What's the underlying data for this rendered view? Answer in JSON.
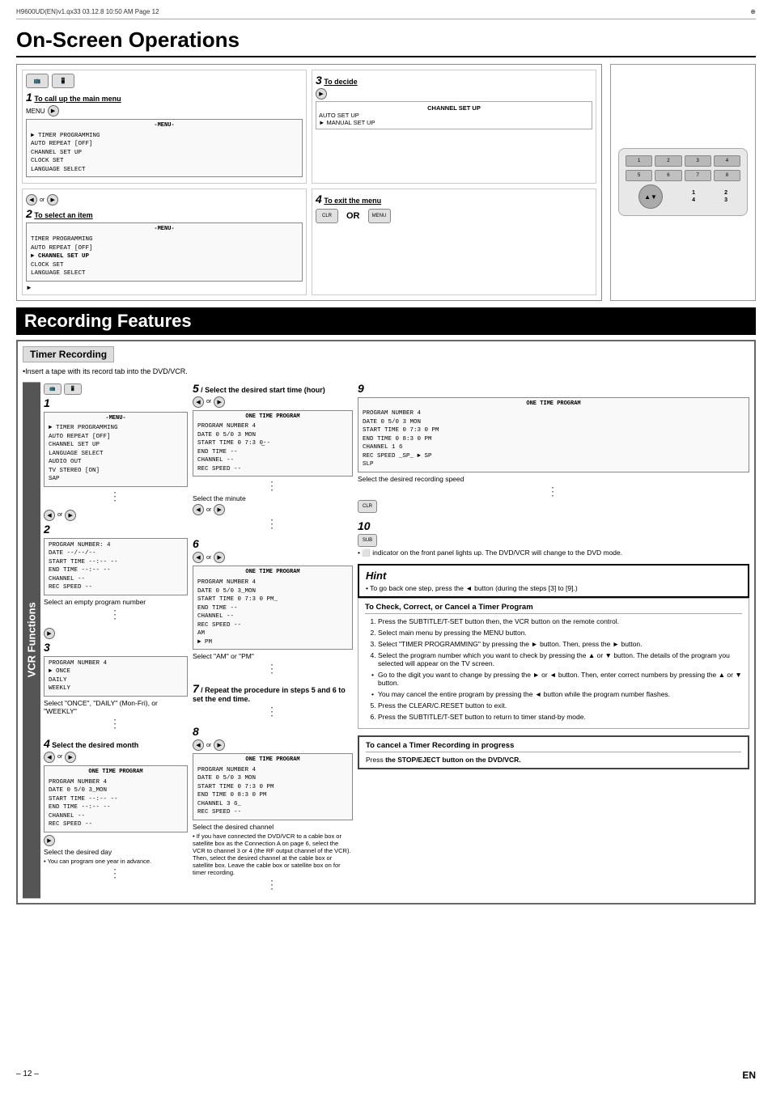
{
  "header": {
    "file_info": "H9600UD(EN)v1.qx33   03.12.8   10:50 AM   Page 12",
    "crosshair": "⊕"
  },
  "page_title": "On-Screen Operations",
  "steps_onscreen": {
    "step1": {
      "num": "1",
      "title": "To call up the main menu",
      "label": "-MENU-",
      "items": [
        "TIMER PROGRAMMING",
        "AUTO REPEAT  [OFF]",
        "CHANNEL SET UP",
        "CLOCK SET",
        "LANGUAGE SELECT"
      ]
    },
    "step2": {
      "num": "2",
      "title": "To select an item",
      "label": "-MENU-",
      "items": [
        "TIMER PROGRAMMING",
        "AUTO REPEAT  [OFF]",
        "► CHANNEL SET UP",
        "CLOCK SET",
        "LANGUAGE SELECT"
      ]
    },
    "step3": {
      "num": "3",
      "title": "To decide",
      "channel_setup": "CHANNEL SET UP",
      "items": [
        "AUTO SET UP",
        "► MANUAL SET UP"
      ]
    },
    "step4": {
      "num": "4",
      "title": "To exit the menu",
      "or_text": "OR"
    }
  },
  "recording_features_title": "Recording Features",
  "timer_recording": {
    "heading": "Timer Recording",
    "insert_note": "•Insert a tape with its record tab into the DVD/VCR.",
    "steps": {
      "step1": {
        "num": "1",
        "screen": {
          "title": "-MENU-",
          "lines": [
            "► TIMER PROGRAMMING",
            "AUTO REPEAT  [OFF]",
            "CHANNEL SET UP",
            "LANGUAGE SELECT",
            "AUDIO OUT",
            "TV STEREO   [ON]",
            "SAP"
          ]
        }
      },
      "step2": {
        "num": "2",
        "desc": "Select an empty program number",
        "screen": {
          "lines": [
            "PROGRAM NUMBER: 4",
            "DATE       --/--/--",
            "START TIME  --:--  --",
            "END TIME    --:--  --",
            "CHANNEL     --",
            "REC SPEED   --"
          ]
        }
      },
      "step3": {
        "num": "3",
        "desc": "Select \"ONCE\", \"DAILY\" (Mon-Fri), or \"WEEKLY\"",
        "screen": {
          "lines": [
            "PROGRAM NUMBER  4",
            "► ONCE",
            "  DAILY",
            "  WEEKLY"
          ]
        }
      },
      "step4": {
        "num": "4",
        "title": "Select the desired month",
        "screen": {
          "title": "ONE TIME PROGRAM",
          "lines": [
            "PROGRAM NUMBER  4",
            "DATE      0 5/0 3_MON",
            "START TIME  --:--  --",
            "END TIME    --:--  --",
            "CHANNEL     --",
            "REC SPEED   --"
          ]
        },
        "desc2": "Select the desired day",
        "note": "• You can program one year in advance."
      },
      "step5": {
        "num": "5",
        "title": "Select the desired start time (hour)",
        "screen": {
          "title": "ONE TIME PROGRAM",
          "lines": [
            "PROGRAM NUMBER  4",
            "DATE      0 5/0 3  MON",
            "START TIME  0 7:3 0̲--",
            "END TIME    --",
            "CHANNEL     --",
            "REC SPEED   --"
          ]
        },
        "desc2": "Select the minute"
      },
      "step6": {
        "num": "6",
        "screen": {
          "title": "ONE TIME PROGRAM",
          "lines": [
            "PROGRAM NUMBER  4",
            "DATE      0 5/0 3_MON",
            "START TIME  0 7:3 0  PM_",
            "END TIME    --",
            "CHANNEL     --",
            "REC SPEED   --",
            "                    AM",
            "                  ► PM"
          ]
        },
        "desc": "Select \"AM\" or \"PM\""
      },
      "step7": {
        "num": "7",
        "title": "Repeat the procedure in steps 5 and 6 to set the end time."
      },
      "step8": {
        "num": "8",
        "screen": {
          "title": "ONE TIME PROGRAM",
          "lines": [
            "PROGRAM NUMBER  4",
            "DATE      0 5/0 3  MON",
            "START TIME  0 7:3 0  PM",
            "END TIME    0 8:3 0  PM",
            "CHANNEL     3 6_",
            "REC SPEED   --"
          ]
        },
        "desc": "Select the desired channel",
        "note": "• If you have connected the DVD/VCR to a cable box or satellite box as the Connection A on page 6, select the VCR to channel 3 or 4 (the RF output channel of the VCR). Then, select the desired channel at the cable box or satellite box. Leave the cable box or satellite box on for timer recording."
      },
      "step9": {
        "num": "9",
        "screen": {
          "title": "ONE TIME PROGRAM",
          "lines": [
            "PROGRAM NUMBER  4",
            "DATE      0 5/0 3  MON",
            "START TIME  0 7:3 0  PM",
            "END TIME    0 8:3 0  PM",
            "CHANNEL     1 6",
            "REC SPEED _SP_  ► SP",
            "                  SLP"
          ]
        },
        "desc": "Select the desired recording speed"
      },
      "step10": {
        "num": "10",
        "desc": "• ⬜ indicator on the front panel lights up. The DVD/VCR will change to the DVD mode."
      }
    }
  },
  "hint": {
    "title": "Hint",
    "text": "• To go back one step, press the ◄ button (during the steps [3] to [9].)"
  },
  "check_correct_cancel": {
    "title": "To Check, Correct, or Cancel a Timer Program",
    "steps": [
      "1) Press the SUBTITLE/T-SET button then, the VCR button on the remote control.",
      "2) Select main menu by pressing the MENU button.",
      "3) Select \"TIMER PROGRAMMING\" by pressing the ► button. Then, press the ► button.",
      "4) Select the program number which you want to check by pressing the ▲ or ▼ button. The details of the program you selected will appear on the TV screen.",
      "• Go to the digit you want to change by pressing the ► or ◄ button. Then, enter correct numbers by pressing the ▲ or ▼ button.",
      "• You may cancel the entire program by pressing the ◄ button while the program number flashes.",
      "5) Press the CLEAR/C.RESET button to exit.",
      "6) Press the SUBTITLE/T-SET button to return to timer stand-by mode."
    ]
  },
  "cancel_timer": {
    "title": "To cancel a Timer Recording in progress",
    "text": "Press the STOP/EJECT button on the DVD/VCR."
  },
  "footer": {
    "page_num": "– 12 –",
    "lang": "EN"
  },
  "vcr_functions_label": "VCR Functions"
}
